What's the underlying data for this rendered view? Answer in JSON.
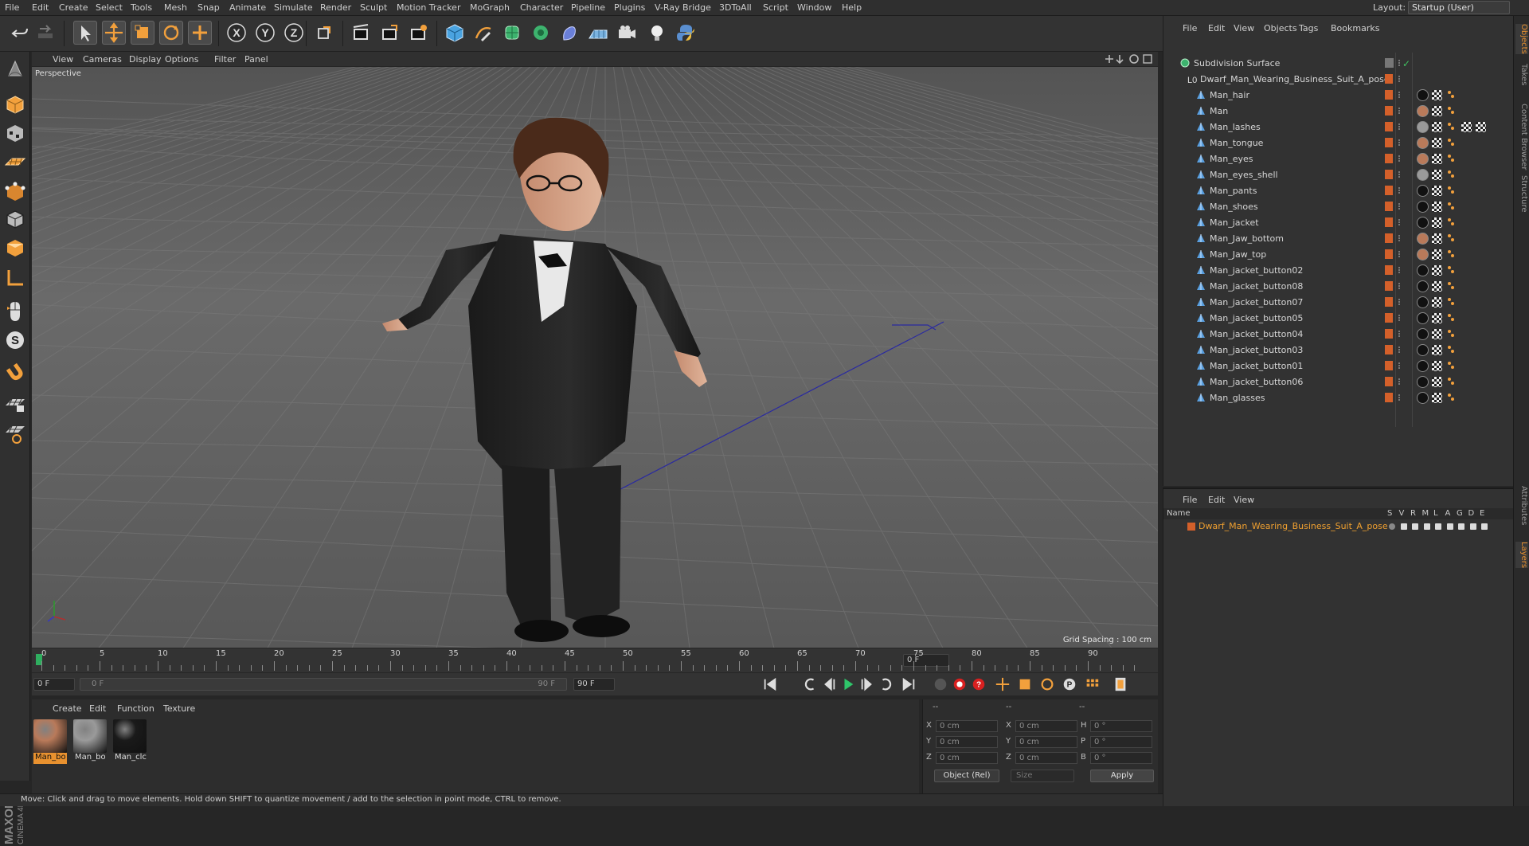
{
  "menubar": {
    "items": [
      "File",
      "Edit",
      "Create",
      "Select",
      "Tools",
      "Mesh",
      "Snap",
      "Animate",
      "Simulate",
      "Render",
      "Sculpt",
      "Motion Tracker",
      "MoGraph",
      "Character",
      "Pipeline",
      "Plugins",
      "V-Ray Bridge",
      "3DToAll",
      "Script",
      "Window",
      "Help"
    ],
    "layout_label": "Layout:",
    "layout_value": "Startup (User)"
  },
  "toolbar": {
    "icons": [
      "undo-icon",
      "redo-icon",
      "select-arrow-icon",
      "move-icon",
      "scale-icon",
      "rotate-icon",
      "add-icon",
      "x-axis-icon",
      "y-axis-icon",
      "z-axis-icon",
      "world-coord-icon",
      "render-view-icon",
      "render-picture-viewer-icon",
      "edit-render-settings-icon",
      "cube-icon",
      "pen-spline-icon",
      "subdivision-icon",
      "array-icon",
      "deformer-icon",
      "floor-icon",
      "camera-icon",
      "light-icon",
      "python-icon"
    ],
    "axis_labels": [
      "X",
      "Y",
      "Z"
    ]
  },
  "left_tools": [
    "make-editable-icon",
    "model-mode-icon",
    "texture-mode-icon",
    "workplane-icon",
    "points-mode-icon",
    "edges-mode-icon",
    "polygons-mode-icon",
    "axis-icon",
    "tweak-icon",
    "snap-icon",
    "magnet-icon",
    "grid-lock-icon",
    "grid-snap-icon"
  ],
  "viewport": {
    "menu": [
      "View",
      "Cameras",
      "Display",
      "Options",
      "Filter",
      "Panel"
    ],
    "camera_label": "Perspective",
    "grid_spacing": "Grid Spacing : 100 cm"
  },
  "timeline": {
    "ticks": [
      "0",
      "5",
      "10",
      "15",
      "20",
      "25",
      "30",
      "35",
      "40",
      "45",
      "50",
      "55",
      "60",
      "65",
      "70",
      "75",
      "80",
      "85",
      "90"
    ],
    "current_frame": "0 F",
    "start_field": "0 F",
    "slider_start": "0 F",
    "slider_end": "90 F",
    "end_field": "90 F"
  },
  "materials": {
    "menu": [
      "Create",
      "Edit",
      "Function",
      "Texture"
    ],
    "items": [
      {
        "label": "Man_bo",
        "color": "#b97a5a",
        "selected": true
      },
      {
        "label": "Man_bo",
        "color": "#9a9a9a",
        "selected": false
      },
      {
        "label": "Man_clc",
        "color": "#1a1a1a",
        "selected": false
      }
    ]
  },
  "coords": {
    "headers": [
      "--",
      "--",
      "--"
    ],
    "rows": [
      {
        "l1": "X",
        "v1": "0 cm",
        "l2": "X",
        "v2": "0 cm",
        "l3": "H",
        "v3": "0 °"
      },
      {
        "l1": "Y",
        "v1": "0 cm",
        "l2": "Y",
        "v2": "0 cm",
        "l3": "P",
        "v3": "0 °"
      },
      {
        "l1": "Z",
        "v1": "0 cm",
        "l2": "Z",
        "v2": "0 cm",
        "l3": "B",
        "v3": "0 °"
      }
    ],
    "mode": "Object (Rel)",
    "size": "Size",
    "apply": "Apply"
  },
  "status": "Move: Click and drag to move elements. Hold down SHIFT to quantize movement / add to the selection in point mode, CTRL to remove.",
  "object_manager": {
    "menu": [
      "File",
      "Edit",
      "View",
      "Objects",
      "Tags",
      "Bookmarks"
    ],
    "root": "Subdivision Surface",
    "group": "Dwarf_Man_Wearing_Business_Suit_A_pose",
    "children": [
      {
        "name": "Man_hair",
        "tag": "#111"
      },
      {
        "name": "Man",
        "tag": "#b97a5a"
      },
      {
        "name": "Man_lashes",
        "tag": "#9a9a9a"
      },
      {
        "name": "Man_tongue",
        "tag": "#b97a5a"
      },
      {
        "name": "Man_eyes",
        "tag": "#b97a5a"
      },
      {
        "name": "Man_eyes_shell",
        "tag": "#9a9a9a"
      },
      {
        "name": "Man_pants",
        "tag": "#111"
      },
      {
        "name": "Man_shoes",
        "tag": "#111"
      },
      {
        "name": "Man_jacket",
        "tag": "#111"
      },
      {
        "name": "Man_Jaw_bottom",
        "tag": "#b97a5a"
      },
      {
        "name": "Man_Jaw_top",
        "tag": "#b97a5a"
      },
      {
        "name": "Man_jacket_button02",
        "tag": "#111"
      },
      {
        "name": "Man_jacket_button08",
        "tag": "#111"
      },
      {
        "name": "Man_jacket_button07",
        "tag": "#111"
      },
      {
        "name": "Man_jacket_button05",
        "tag": "#111"
      },
      {
        "name": "Man_jacket_button04",
        "tag": "#111"
      },
      {
        "name": "Man_jacket_button03",
        "tag": "#111"
      },
      {
        "name": "Man_jacket_button01",
        "tag": "#111"
      },
      {
        "name": "Man_jacket_button06",
        "tag": "#111"
      },
      {
        "name": "Man_glasses",
        "tag": "#111"
      }
    ]
  },
  "layer_manager": {
    "menu": [
      "File",
      "Edit",
      "View"
    ],
    "name_header": "Name",
    "columns": [
      "S",
      "V",
      "R",
      "M",
      "L",
      "A",
      "G",
      "D",
      "E"
    ],
    "layer": "Dwarf_Man_Wearing_Business_Suit_A_pose"
  },
  "side_tabs": [
    "Objects",
    "Takes",
    "Content Browser",
    "Structure",
    "Attributes",
    "Layers"
  ],
  "colors": {
    "accent": "#e8912f",
    "layer_text": "#f0a030",
    "object_swatch": "#d4602a"
  }
}
